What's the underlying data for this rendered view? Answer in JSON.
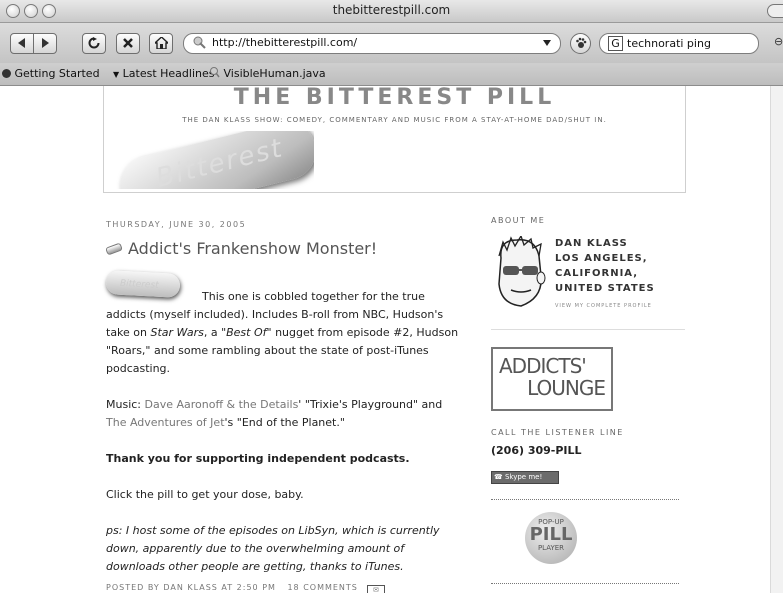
{
  "window": {
    "title": "thebitterestpill.com"
  },
  "toolbar": {
    "url": "http://thebitterestpill.com/",
    "search_value": "technorati ping"
  },
  "bookmarks": [
    {
      "label": "Getting Started"
    },
    {
      "label": "Latest Headlines"
    },
    {
      "label": "VisibleHuman.java"
    }
  ],
  "header": {
    "title": "THE BITTEREST PILL",
    "tagline": "THE DAN KLASS SHOW: COMEDY, COMMENTARY AND MUSIC FROM A STAY-AT-HOME DAD/SHUT IN.",
    "pill_text": "Bitterest"
  },
  "post": {
    "date": "THURSDAY, JUNE 30, 2005",
    "title": "Addict's Frankenshow Monster!",
    "pill_text": "Bitterest",
    "p1_a": "This one is cobbled together for the true addicts (myself included). Includes B-roll from NBC, Hudson's take on ",
    "p1_i1": "Star Wars",
    "p1_b": ", a ",
    "p1_i2": "\"Best Of\"",
    "p1_c": " nugget from episode #2, Hudson \"Roars,\" and some rambling about the state of post-iTunes podcasting.",
    "music_prefix": "Music: ",
    "music_link1": "Dave Aaronoff & the Details",
    "music_mid1": "' \"Trixie's Playground\" and ",
    "music_link2": "The Adventures of Jet",
    "music_end": "'s \"End of the Planet.\"",
    "thanks": "Thank you for supporting independent podcasts.",
    "click": "Click the pill to get your dose, baby.",
    "ps": "ps: I host some of the episodes on LibSyn, which is currently down, apparently due to the overwhelming amount of downloads other people are getting, thanks to iTunes.",
    "footer_posted": "POSTED BY DAN KLASS AT 2:50 PM",
    "footer_comments": "18 COMMENTS"
  },
  "sidebar": {
    "about_heading": "ABOUT ME",
    "name": "DAN KLASS",
    "location": "LOS ANGELES, CALIFORNIA, UNITED STATES",
    "view_profile": "VIEW MY COMPLETE PROFILE",
    "lounge_line1": "ADDICTS'",
    "lounge_line2": "LOUNGE",
    "listener_heading": "CALL THE LISTENER LINE",
    "phone": "(206) 309-PILL",
    "skype": "Skype me!",
    "popup_line1": "POP-UP",
    "popup_line2": "PILL",
    "popup_line3": "PLAYER"
  }
}
